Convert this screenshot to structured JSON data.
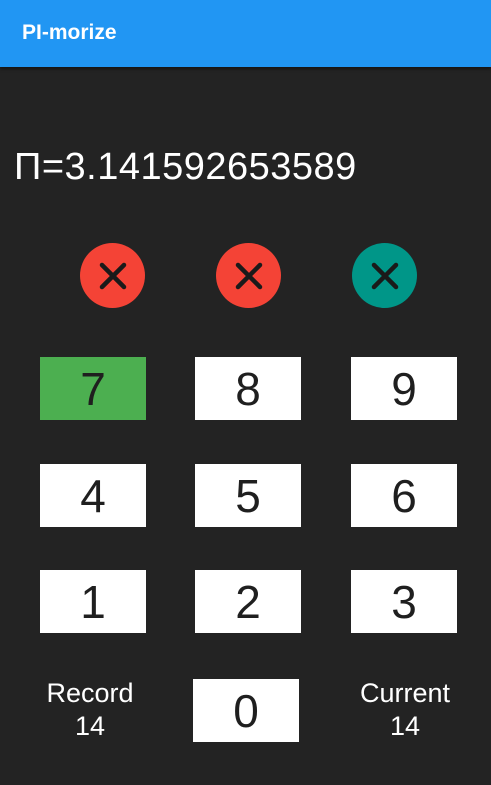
{
  "app": {
    "title": "PI-morize"
  },
  "display": {
    "text": "П=3.141592653589"
  },
  "lives": [
    {
      "icon": "close-icon",
      "color": "#F44336"
    },
    {
      "icon": "close-icon",
      "color": "#F44336"
    },
    {
      "icon": "close-icon",
      "color": "#009688"
    }
  ],
  "keypad": {
    "keys": [
      "7",
      "8",
      "9",
      "4",
      "5",
      "6",
      "1",
      "2",
      "3",
      "0"
    ],
    "highlight_color": "#4CAF50",
    "key_color": "#FFFFFF"
  },
  "stats": {
    "record_label": "Record",
    "record_value": "14",
    "current_label": "Current",
    "current_value": "14"
  }
}
